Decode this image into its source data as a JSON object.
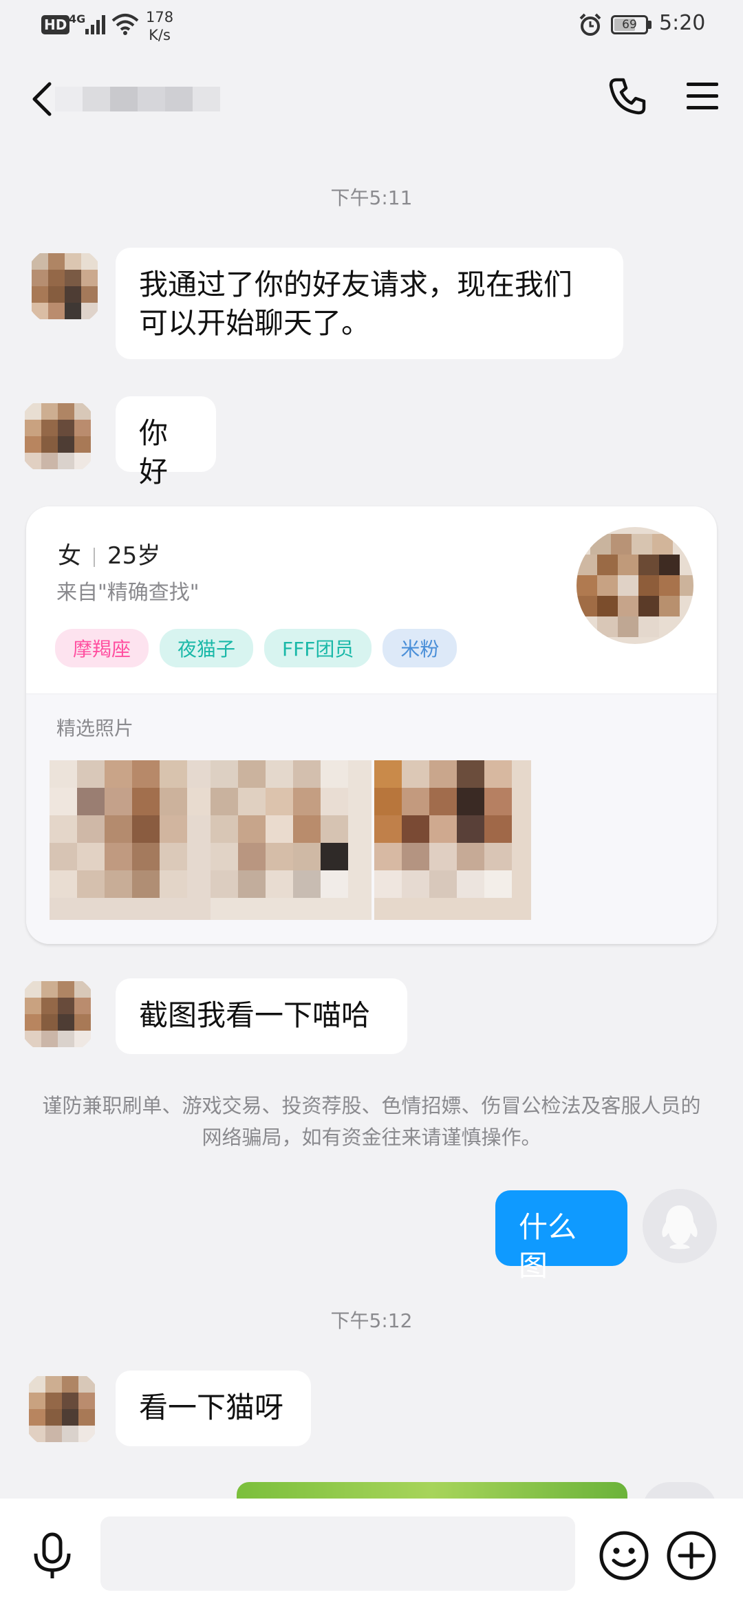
{
  "status_bar": {
    "hd": "HD",
    "network": "4G",
    "speed_value": "178",
    "speed_unit": "K/s",
    "battery": "69",
    "time": "5:20"
  },
  "header": {
    "contact_name": ""
  },
  "messages": {
    "ts1": "下午5:11",
    "m1": "我通过了你的好友请求，现在我们可以开始聊天了。",
    "m2": "你好",
    "m3": "截图我看一下喵哈",
    "notice": "谨防兼职刷单、游戏交易、投资荐股、色情招嫖、伤冒公检法及客服人员的网络骗局，如有资金往来请谨慎操作。",
    "m4": "什么图",
    "ts2": "下午5:12",
    "m5": "看一下猫呀"
  },
  "profile_card": {
    "gender": "女",
    "age": "25岁",
    "source": "来自\"精确查找\"",
    "tags": [
      "摩羯座",
      "夜猫子",
      "FFF团员",
      "米粉"
    ],
    "photos_label": "精选照片"
  },
  "colors": {
    "background": "#f2f2f4",
    "my_bubble": "#0f9aff",
    "tag_pink": "#ff4fa0",
    "tag_teal": "#1ab8a8",
    "tag_blue": "#4a8fd8"
  }
}
